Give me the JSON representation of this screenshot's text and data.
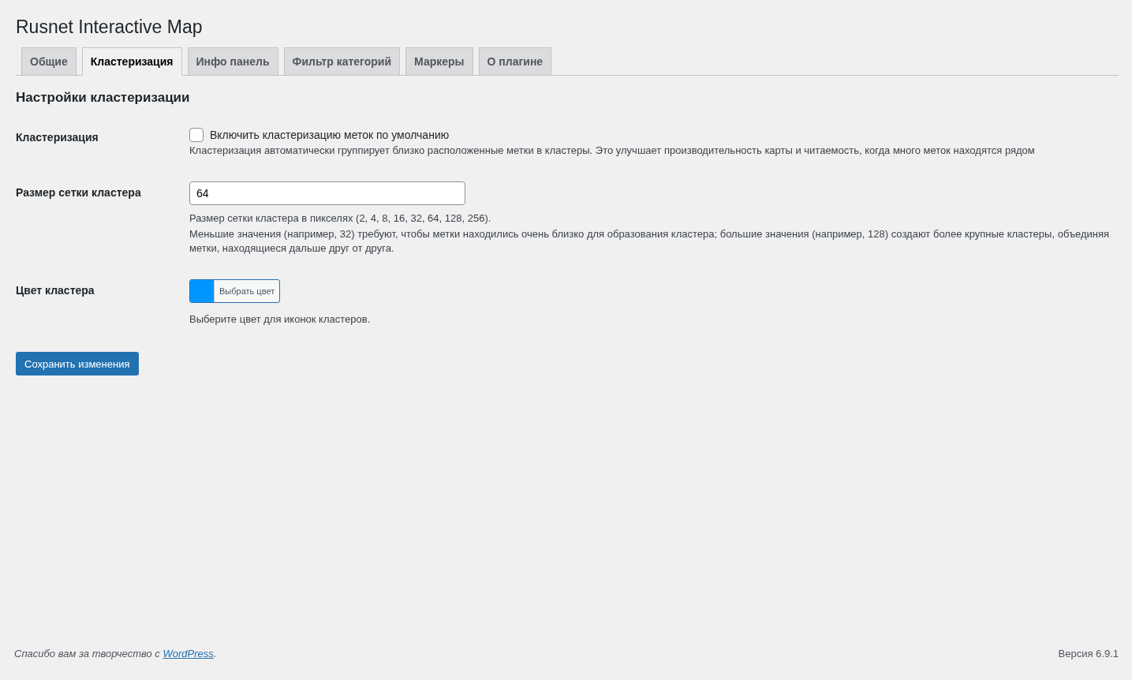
{
  "title": "Rusnet Interactive Map",
  "tabs": [
    {
      "label": "Общие",
      "selected": false
    },
    {
      "label": "Кластеризация",
      "selected": true
    },
    {
      "label": "Инфо панель",
      "selected": false
    },
    {
      "label": "Фильтр категорий",
      "selected": false
    },
    {
      "label": "Маркеры",
      "selected": false
    },
    {
      "label": "О плагине",
      "selected": false
    }
  ],
  "section_title": "Настройки кластеризации",
  "fields": [
    {
      "kind": "checkbox",
      "label": "Кластеризация",
      "checkbox_label": "Включить кластеризацию меток по умолчанию",
      "checked": false,
      "descriptions": [
        "Кластеризация автоматически группирует близко расположенные метки в кластеры. Это улучшает производительность карты и читаемость, когда много меток находятся рядом"
      ]
    },
    {
      "kind": "text",
      "label": "Размер сетки кластера",
      "value": "64",
      "descriptions": [
        "Размер сетки кластера в пикселях (2, 4, 8, 16, 32, 64, 128, 256).",
        "Меньшие значения (например, 32) требуют, чтобы метки находились очень близко для образования кластера; большие значения (например, 128) создают более крупные кластеры, объединяя метки, находящиеся дальше друг от друга."
      ]
    },
    {
      "kind": "color",
      "label": "Цвет кластера",
      "button_label": "Выбрать цвет",
      "color": "#0096ff",
      "descriptions": [
        "Выберите цвет для иконок кластеров."
      ]
    }
  ],
  "save_button": "Сохранить изменения",
  "footer": {
    "before": "Спасибо вам за творчество с ",
    "link": "WordPress",
    "after": ".",
    "version": "Версия 6.9.1"
  }
}
